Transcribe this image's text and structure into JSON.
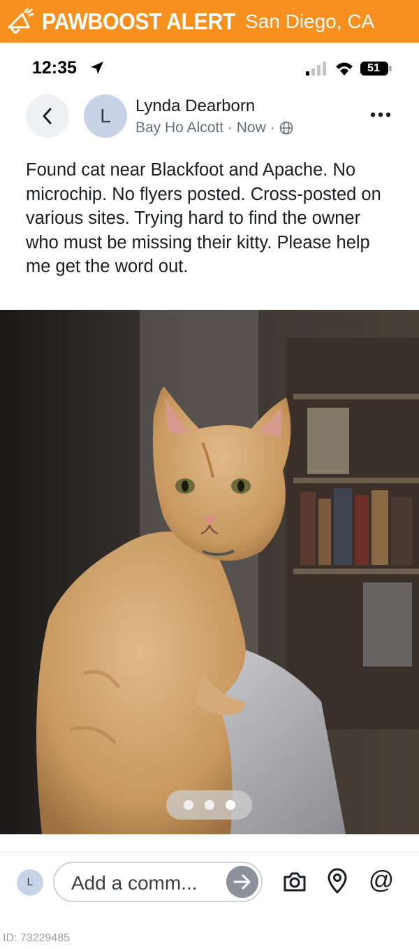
{
  "banner": {
    "brand": "PAWBOOST ALERT",
    "city": "San Diego, CA",
    "icon": "megaphone-icon",
    "color": "#f7901e"
  },
  "status_bar": {
    "time": "12:35",
    "battery": "51",
    "icons": [
      "location-arrow-icon",
      "signal-icon",
      "wifi-icon",
      "battery-icon"
    ]
  },
  "post": {
    "author": "Lynda Dearborn",
    "avatar_initial": "L",
    "neighborhood": "Bay Ho Alcott",
    "time": "Now",
    "visibility_icon": "globe-icon",
    "text": "Found cat near Blackfoot and Apache. No microchip.  No flyers posted.  Cross-posted on various sites.  Trying hard to find the owner who must be missing their kitty.  Please help me get the word out.",
    "photo": {
      "carousel_count": 3,
      "carousel_active_index": 2
    }
  },
  "comment_bar": {
    "avatar_initial": "L",
    "placeholder": "Add a comm...",
    "at_label": "@",
    "icons": [
      "send-arrow-icon",
      "camera-icon",
      "location-pin-icon"
    ]
  },
  "footer": {
    "id_text": "ID: 73229485"
  }
}
